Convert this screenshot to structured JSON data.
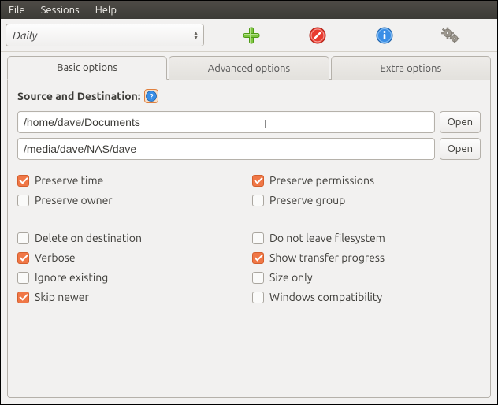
{
  "menubar": {
    "file": "File",
    "sessions": "Sessions",
    "help": "Help"
  },
  "toolbar": {
    "session_name": "Daily"
  },
  "tabs": {
    "basic": "Basic options",
    "advanced": "Advanced options",
    "extra": "Extra options"
  },
  "sd": {
    "label": "Source and Destination:",
    "source_path": "/home/dave/Documents",
    "dest_path": "/media/dave/NAS/dave",
    "open": "Open"
  },
  "options": {
    "preserve_time": {
      "label": "Preserve time",
      "checked": true
    },
    "preserve_permissions": {
      "label": "Preserve permissions",
      "checked": true
    },
    "preserve_owner": {
      "label": "Preserve owner",
      "checked": false
    },
    "preserve_group": {
      "label": "Preserve group",
      "checked": false
    },
    "delete_on_dest": {
      "label": "Delete on destination",
      "checked": false
    },
    "no_leave_fs": {
      "label": "Do not leave filesystem",
      "checked": false
    },
    "verbose": {
      "label": "Verbose",
      "checked": true
    },
    "show_progress": {
      "label": "Show transfer progress",
      "checked": true
    },
    "ignore_existing": {
      "label": "Ignore existing",
      "checked": false
    },
    "size_only": {
      "label": "Size only",
      "checked": false
    },
    "skip_newer": {
      "label": "Skip newer",
      "checked": true
    },
    "windows_compat": {
      "label": "Windows compatibility",
      "checked": false
    }
  }
}
